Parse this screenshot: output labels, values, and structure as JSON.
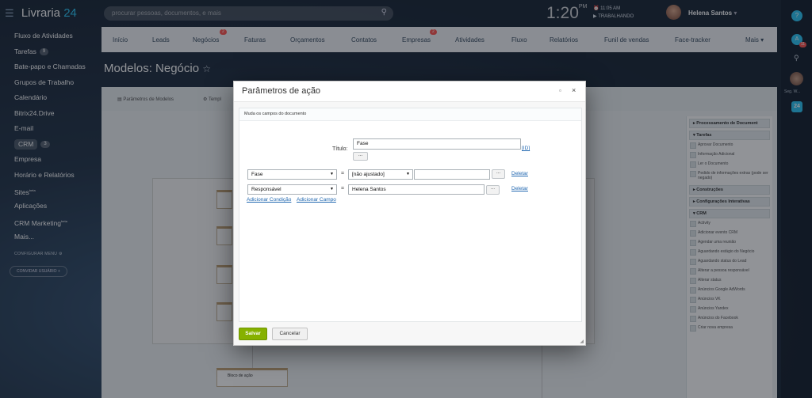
{
  "header": {
    "logo_text": "Livraria",
    "logo_num": "24",
    "search_placeholder": "procurar pessoas, documentos, e mais",
    "clock_time": "1:20",
    "clock_ampm": "PM",
    "clock_alarm": "11:05 AM",
    "clock_status": "TRABALHANDO",
    "user_name": "Helena Santos"
  },
  "left_menu": {
    "items": [
      {
        "label": "Fluxo de Atividades"
      },
      {
        "label": "Tarefas",
        "count": "9"
      },
      {
        "label": "Bate-papo e Chamadas"
      },
      {
        "label": "Grupos de Trabalho"
      },
      {
        "label": "Calendário"
      },
      {
        "label": "Bitrix24.Drive"
      },
      {
        "label": "E-mail"
      },
      {
        "label": "CRM",
        "count": "3"
      },
      {
        "label": "Empresa"
      },
      {
        "label": "Horário e Relatórios"
      },
      {
        "label": "Sites",
        "sup": "beta"
      },
      {
        "label": "Aplicações"
      },
      {
        "label": "CRM Marketing",
        "sup": "beta"
      },
      {
        "label": "Mais..."
      }
    ],
    "configure": "CONFIGURAR MENU",
    "invite": "CONVIDAR USUÁRIO"
  },
  "crm_nav": {
    "tabs": [
      "Início",
      "Leads",
      "Negócios",
      "Faturas",
      "Orçamentos",
      "Contatos",
      "Empresas",
      "Atividades",
      "Fluxo",
      "Relatórios",
      "Funil de vendas",
      "Face-tracker",
      "Mais"
    ],
    "badge_negocios": "2",
    "badge_empresas": "2"
  },
  "page": {
    "title": "Modelos: Negócio",
    "star": "☆"
  },
  "work": {
    "tab1": "Parâmetros de Modelos",
    "tab2": "Templ"
  },
  "side_panel": {
    "sections": [
      {
        "head": "▸ Processamento de Document"
      },
      {
        "head": "▾ Tarefas",
        "items": [
          "Aprovar Documento",
          "Informação Adicional",
          "Ler o Documento",
          "Pedido de informações extras (pode ser negado)"
        ]
      },
      {
        "head": "▸ Construções"
      },
      {
        "head": "▸ Configurações Interativas"
      },
      {
        "head": "▾ CRM",
        "items": [
          "Activity",
          "Adicionar evento CRM",
          "Agendar uma reunião",
          "Aguardando estágio do Negócio",
          "Aguardando status do Lead",
          "Alterar a pessoa responsável",
          "Alterar status",
          "Anúncios Google AdWords",
          "Anúncios VK",
          "Anúncios Yandex",
          "Anúncios do Facebook",
          "Criar nova empresa"
        ]
      }
    ]
  },
  "canvas": {
    "block_label": "Bloco de ação"
  },
  "modal": {
    "title": "Parâmetros de ação",
    "maximize_icon": "▫",
    "close_icon": "×",
    "description": "Muda os campos do documento",
    "title_label": "Título:",
    "title_value": "Fase",
    "title_dots": "...",
    "id_link": "[ID]",
    "row1": {
      "field": "Fase",
      "eq": "=",
      "value_select": "[não ajustado]",
      "input_value": "",
      "dots": "...",
      "delete": "Deletar"
    },
    "row2": {
      "field": "Responsável",
      "eq": "=",
      "input_value": "Helena Santos",
      "dots": "...",
      "delete": "Deletar"
    },
    "add_condition": "Adicionar Condição",
    "add_field": "Adicionar Campo",
    "save": "Salvar",
    "cancel": "Cancelar"
  },
  "rail": {
    "help": "?",
    "badge": "11",
    "search_icon": "⚲",
    "user_short": "Seg. W...",
    "b24": "24"
  }
}
